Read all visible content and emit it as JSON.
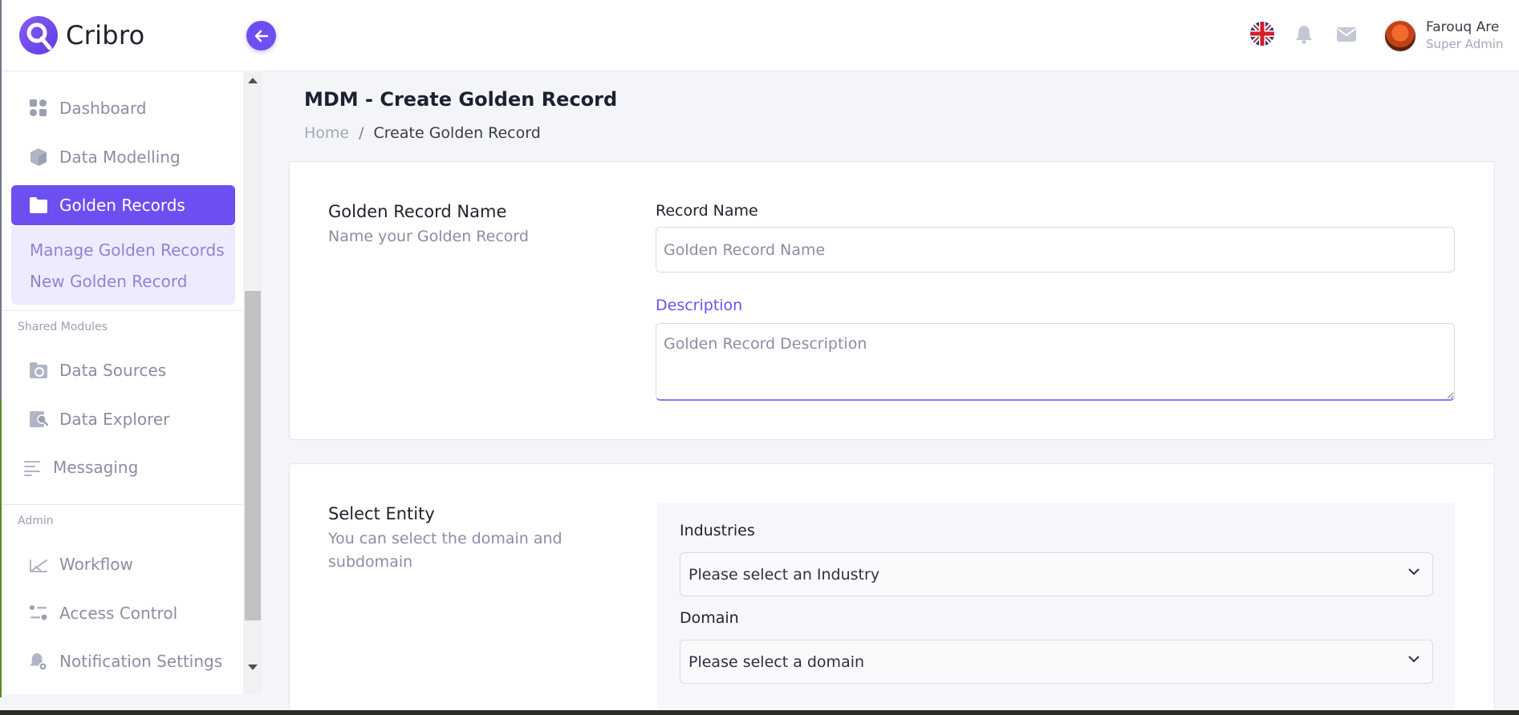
{
  "app": {
    "brand": "Cribro"
  },
  "user": {
    "name": "Farouq Are",
    "role": "Super Admin"
  },
  "sidebar": {
    "items": [
      {
        "label": "Dashboard",
        "icon": "dashboard-icon"
      },
      {
        "label": "Data Modelling",
        "icon": "cube-icon"
      },
      {
        "label": "Golden Records",
        "icon": "folder-icon",
        "active": true
      }
    ],
    "submenu": [
      "Manage Golden Records",
      "New Golden Record"
    ],
    "shared_label": "Shared Modules",
    "shared_items": [
      {
        "label": "Data Sources",
        "icon": "data-sources-icon"
      },
      {
        "label": "Data Explorer",
        "icon": "data-explorer-icon"
      },
      {
        "label": "Messaging",
        "icon": "messaging-icon"
      }
    ],
    "admin_label": "Admin",
    "admin_items": [
      {
        "label": "Workflow",
        "icon": "workflow-icon"
      },
      {
        "label": "Access Control",
        "icon": "access-control-icon"
      },
      {
        "label": "Notification Settings",
        "icon": "notification-settings-icon"
      }
    ]
  },
  "page": {
    "title": "MDM - Create Golden Record",
    "breadcrumb": {
      "home": "Home",
      "separator": "/",
      "current": "Create Golden Record"
    }
  },
  "golden_record_card": {
    "title": "Golden Record Name",
    "subtitle": "Name your Golden Record",
    "record_name_label": "Record Name",
    "record_name_placeholder": "Golden Record Name",
    "description_label": "Description",
    "description_placeholder": "Golden Record Description"
  },
  "entity_card": {
    "title": "Select Entity",
    "subtitle": "You can select the domain and subdomain",
    "industries_label": "Industries",
    "industries_value": "Please select an Industry",
    "domain_label": "Domain",
    "domain_value": "Please select a domain"
  },
  "colors": {
    "accent": "#6d4ff1",
    "accent_light": "#efebfe"
  }
}
